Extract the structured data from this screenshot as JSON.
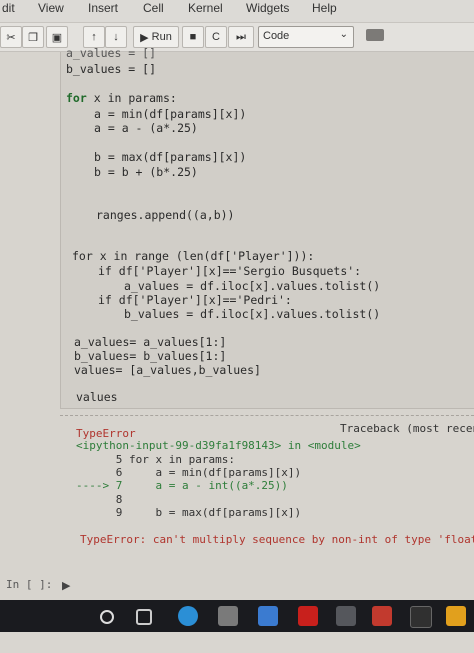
{
  "menu": [
    "dit",
    "View",
    "Insert",
    "Cell",
    "Kernel",
    "Widgets",
    "Help"
  ],
  "toolbar": {
    "run_label": "Run",
    "cell_type": "Code",
    "fastforward": "⏭"
  },
  "code_lines": [
    "a_values = []",
    "b_values = []",
    "for x in params:",
    "a = min(df[params][x])",
    "a = a - (a*.25)",
    "b = max(df[params][x])",
    "b = b + (b*.25)",
    "ranges.append((a,b))",
    "for x in range (len(df['Player'])):",
    "if df['Player'][x]=='Sergio Busquets':",
    "a_values = df.iloc[x].values.tolist()",
    "if df['Player'][x]=='Pedri':",
    "b_values = df.iloc[x].values.tolist()",
    "a_values= a_values[1:]",
    "b_values= b_values[1:]",
    "values= [a_values,b_values]",
    "values"
  ],
  "traceback": {
    "error_name": "TypeError",
    "header_right": "Traceback (most recent",
    "location": "<ipython-input-99-d39fa1f98143> in <module>",
    "lines": [
      "      5 for x in params:",
      "      6     a = min(df[params][x])",
      "----> 7     a = a - int((a*.25))",
      "      8",
      "      9     b = max(df[params][x])"
    ],
    "message": "TypeError: can't multiply sequence by non-int of type 'float'"
  },
  "next_prompt": "In [ ]:"
}
